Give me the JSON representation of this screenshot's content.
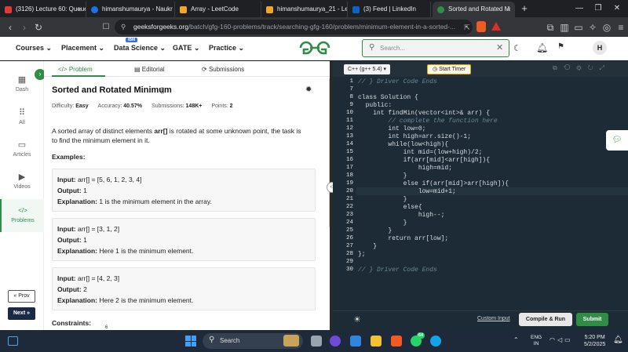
{
  "browser": {
    "tabs": [
      {
        "title": "(3126) Lecture 60: Queue",
        "color": "#e53935"
      },
      {
        "title": "himanshumaurya - Naukr",
        "color": "#1a73e8"
      },
      {
        "title": "Array - LeetCode",
        "color": "#f5a623"
      },
      {
        "title": "himanshumaurya_21 - Le",
        "color": "#f5a623"
      },
      {
        "title": "(3) Feed | LinkedIn",
        "color": "#0a66c2"
      },
      {
        "title": "Sorted and Rotated M",
        "color": "#2f8d46",
        "active": true
      }
    ],
    "new_tab": "+",
    "url_domain": "geeksforgeeks.org",
    "url_path": "/batch/gfg-160-problems/track/searching-gfg-160/problem/minimum-element-in-a-sorted-..."
  },
  "header": {
    "nav": [
      "Courses",
      "Placement",
      "Data Science",
      "GATE",
      "Practice"
    ],
    "ibm_badge": "IBM",
    "search_placeholder": "Search...",
    "avatar": "H"
  },
  "rail": {
    "items": [
      {
        "label": "Dash",
        "icon": "dashboard-icon"
      },
      {
        "label": "All",
        "icon": "grid-icon"
      },
      {
        "label": "Articles",
        "icon": "book-icon"
      },
      {
        "label": "Videos",
        "icon": "video-icon"
      },
      {
        "label": "Problems",
        "icon": "code-icon"
      }
    ],
    "prev": "« Prov",
    "next": "Next »"
  },
  "problem": {
    "tabs": [
      "Problem",
      "Editorial",
      "Submissions"
    ],
    "tab_icons": [
      "</>",
      "▤",
      "⟳"
    ],
    "title": "Sorted and Rotated Minimum",
    "difficulty_label": "Difficulty:",
    "difficulty": "Easy",
    "accuracy_label": "Accuracy:",
    "accuracy": "40.57%",
    "submissions_label": "Submissions:",
    "submissions": "148K+",
    "points_label": "Points:",
    "points": "2",
    "desc_1": "A sorted array of distinct elements",
    "desc_arr": "arr[]",
    "desc_2": "is rotated at some unknown point, the task is",
    "desc_3": "to find the minimum element in it.",
    "examples_title": "Examples:",
    "examples": [
      {
        "input": "arr[] = [5, 6, 1, 2, 3, 4]",
        "output": "1",
        "explanation": "1 is the minimum element in the array."
      },
      {
        "input": "arr[] = [3, 1, 2]",
        "output": "1",
        "explanation": "Here 1 is the minimum element."
      },
      {
        "input": "arr[] = [4, 2, 3]",
        "output": "2",
        "explanation": "Here 2 is the minimum element."
      }
    ],
    "input_label": "Input:",
    "output_label": "Output:",
    "explanation_label": "Explanation:",
    "constraints_title": "Constraints:",
    "constraints_cut": "6"
  },
  "editor": {
    "language": "C++ (g++ 5.4)",
    "timer": "Start Timer",
    "lines": [
      {
        "n": "1",
        "t": "// } Driver Code Ends",
        "c": "comment"
      },
      {
        "n": "7",
        "t": "",
        "c": "plain"
      },
      {
        "n": "8",
        "t": "class Solution {",
        "c": "plain"
      },
      {
        "n": "9",
        "t": "  public:",
        "c": "plain"
      },
      {
        "n": "10",
        "t": "    int findMin(vector<int>& arr) {",
        "c": "plain"
      },
      {
        "n": "11",
        "t": "        // complete the function here",
        "c": "comment"
      },
      {
        "n": "12",
        "t": "        int low=0;",
        "c": "plain"
      },
      {
        "n": "13",
        "t": "        int high=arr.size()-1;",
        "c": "plain"
      },
      {
        "n": "14",
        "t": "        while(low<high){",
        "c": "plain"
      },
      {
        "n": "15",
        "t": "            int mid=(low+high)/2;",
        "c": "plain"
      },
      {
        "n": "16",
        "t": "            if(arr[mid]<arr[high]){",
        "c": "plain"
      },
      {
        "n": "17",
        "t": "                high=mid;",
        "c": "plain"
      },
      {
        "n": "18",
        "t": "            }",
        "c": "plain"
      },
      {
        "n": "19",
        "t": "            else if(arr[mid]>arr[high]){",
        "c": "plain"
      },
      {
        "n": "20",
        "t": "                low=mid+1;",
        "c": "plain"
      },
      {
        "n": "21",
        "t": "            }",
        "c": "plain"
      },
      {
        "n": "22",
        "t": "            else{",
        "c": "plain"
      },
      {
        "n": "23",
        "t": "                high--;",
        "c": "plain"
      },
      {
        "n": "24",
        "t": "            }",
        "c": "plain"
      },
      {
        "n": "25",
        "t": "        }",
        "c": "plain"
      },
      {
        "n": "26",
        "t": "        return arr[low];",
        "c": "plain"
      },
      {
        "n": "27",
        "t": "    }",
        "c": "plain"
      },
      {
        "n": "28",
        "t": "};",
        "c": "plain"
      },
      {
        "n": "29",
        "t": "",
        "c": "plain"
      },
      {
        "n": "30",
        "t": "// } Driver Code Ends",
        "c": "comment"
      }
    ],
    "custom_input": "Custom Input",
    "compile_run": "Compile & Run",
    "submit": "Submit"
  },
  "taskbar": {
    "search": "Search",
    "whatsapp_badge": "64",
    "lang_1": "ENG",
    "lang_2": "IN",
    "time": "5:20 PM",
    "date": "5/2/2025"
  },
  "colors": {
    "brand_green": "#2f8d46",
    "editor_bg": "#1c2b35",
    "taskbar": "#1e2a3a"
  }
}
